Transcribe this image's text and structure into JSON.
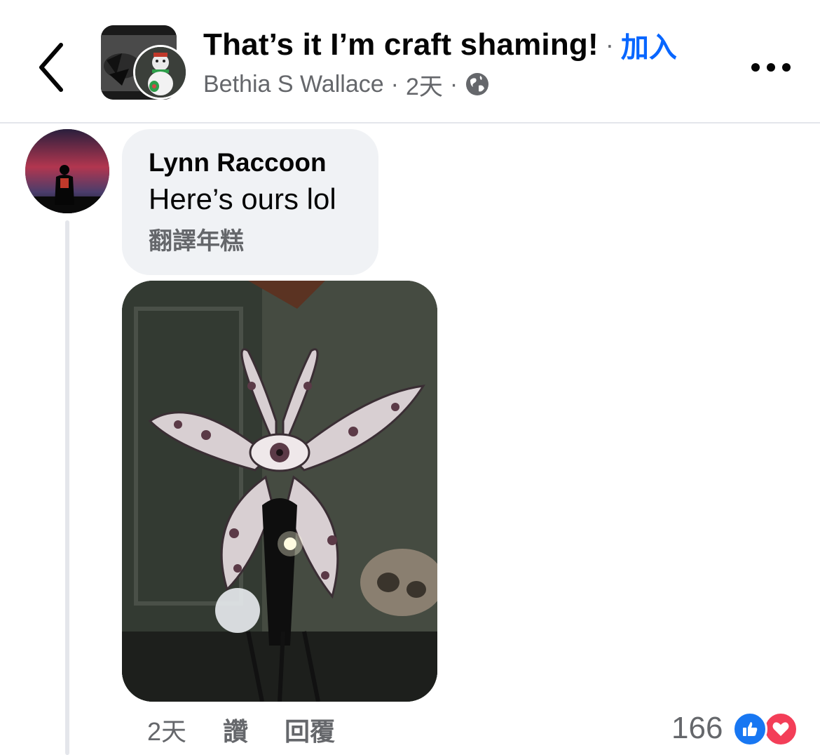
{
  "header": {
    "group_title": "That’s it I’m craft shaming!",
    "separator": "·",
    "join_label": "加入",
    "poster_name": "Bethia S Wallace",
    "post_time": "2天",
    "privacy_icon": "globe-icon",
    "back_icon": "chevron-left-icon",
    "more_icon": "more-horizontal-icon"
  },
  "comment": {
    "author": "Lynn Raccoon",
    "text": "Here’s ours lol",
    "translate_label": "翻譯年糕",
    "photo_description_icon": "photo",
    "time": "2天",
    "like_label": "讚",
    "reply_label": "回覆",
    "reaction_count": "166",
    "reaction_icons": [
      "like-icon",
      "love-icon"
    ]
  },
  "colors": {
    "accent": "#0866ff",
    "secondary_text": "#65676b",
    "bubble_bg": "#f0f2f5",
    "like": "#1877f2",
    "love": "#f33e58"
  }
}
